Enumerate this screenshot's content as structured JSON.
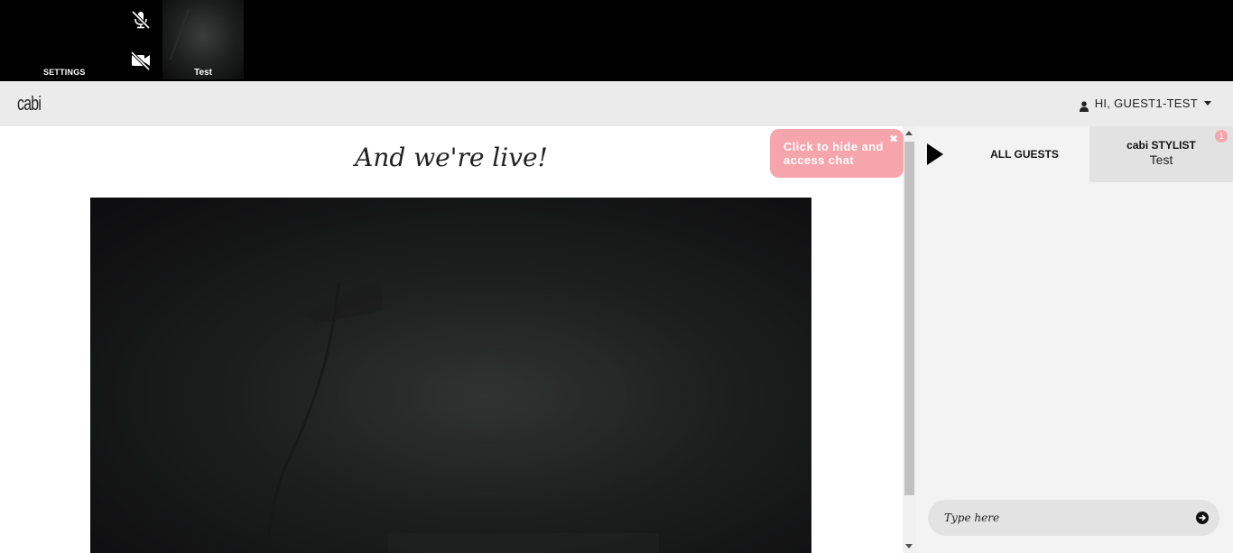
{
  "topbar": {
    "settings_label": "SETTINGS",
    "mic_icon": "mic-off-icon",
    "camera_icon": "camera-off-icon",
    "participant_label": "Test"
  },
  "header": {
    "logo": "cabi",
    "user_icon": "user-icon",
    "user_name": "HI, GUEST1-TEST"
  },
  "main": {
    "title": "And we're live!"
  },
  "tooltip": {
    "text": "Click to hide and access chat",
    "close_glyph": "✖"
  },
  "chat": {
    "tabs": [
      {
        "label": "ALL GUESTS"
      },
      {
        "label": "cabi STYLIST",
        "sublabel": "Test",
        "badge": "1"
      }
    ],
    "input_placeholder": "Type here",
    "send_icon": "arrow-right-circle-icon"
  },
  "colors": {
    "accent_pink": "#f7a5ad",
    "header_bg": "#ebebeb",
    "chat_bg": "#f3f3f3"
  }
}
